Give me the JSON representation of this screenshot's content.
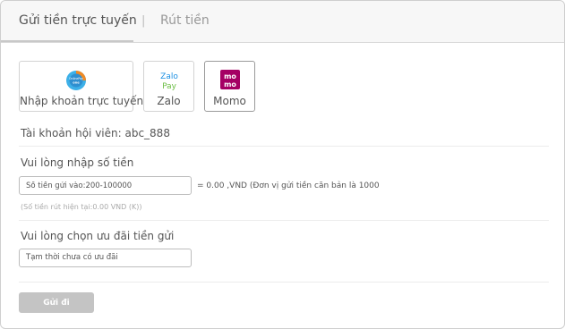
{
  "tabs": {
    "deposit": "Gửi tiền trực tuyến",
    "separator": "|",
    "withdraw": "Rút tiền"
  },
  "methods": [
    {
      "name": "Nhập khoản trực tuyến",
      "icon": "online-bank-icon",
      "badge_top": "OnlinePay",
      "badge_bottom": "one"
    },
    {
      "name": "Zalo",
      "icon": "zalopay-icon",
      "logo_top": "Zalo",
      "logo_bottom": "Pay"
    },
    {
      "name": "Momo",
      "icon": "momo-icon",
      "logo_top": "mo",
      "logo_bottom": "mo"
    }
  ],
  "account": {
    "label": "Tài khoản hội viên: abc_888"
  },
  "amount": {
    "label": "Vui lòng nhập số tiền",
    "placeholder": "Số tiền gửi vào:200-100000",
    "conversion": "= 0.00 ,VND (Đơn vị gửi tiền căn bản là 1000",
    "note": "(Số tiền rút hiện tại:0.00 VND (K))"
  },
  "promo": {
    "label": "Vui lòng chọn ưu đãi tiền gửi",
    "value": "Tạm thời chưa có ưu đãi"
  },
  "submit": "Gửi đi",
  "colors": {
    "zalo_blue": "#1a8fe3",
    "zalo_green": "#6cbe45",
    "momo_pink": "#a50064",
    "online_blue": "#3db0e8",
    "online_orange": "#f08a24"
  }
}
